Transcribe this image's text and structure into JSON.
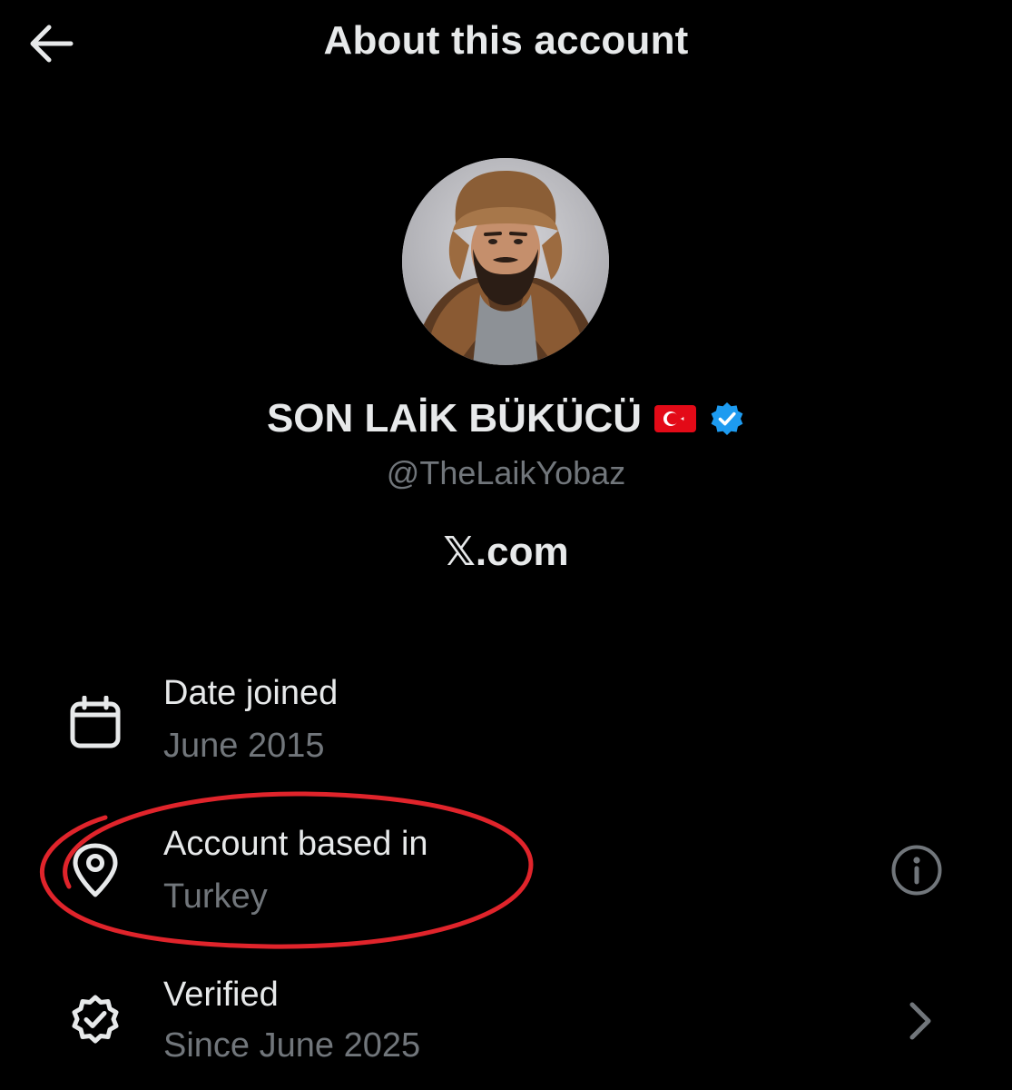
{
  "header": {
    "title": "About this account",
    "back_icon": "arrow-left-icon"
  },
  "profile": {
    "display_name": "SON LAİK BÜKÜCÜ",
    "flag": "turkey-flag",
    "verified_badge": "verified-badge-icon",
    "handle": "@TheLaikYobaz",
    "site": "𝕏.com"
  },
  "details": [
    {
      "icon": "calendar-icon",
      "title": "Date joined",
      "value": "June 2015"
    },
    {
      "icon": "location-pin-icon",
      "title": "Account based in",
      "value": "Turkey",
      "action_icon": "info-icon"
    },
    {
      "icon": "verified-check-icon",
      "title": "Verified",
      "value": "Since June 2025",
      "action_icon": "chevron-right-icon"
    }
  ],
  "colors": {
    "background": "#000000",
    "primary_text": "#e7e9ea",
    "secondary_text": "#71767b",
    "verified_blue": "#1d9bf0",
    "annotation_red": "#e0242b",
    "flag_red": "#e30a17"
  }
}
